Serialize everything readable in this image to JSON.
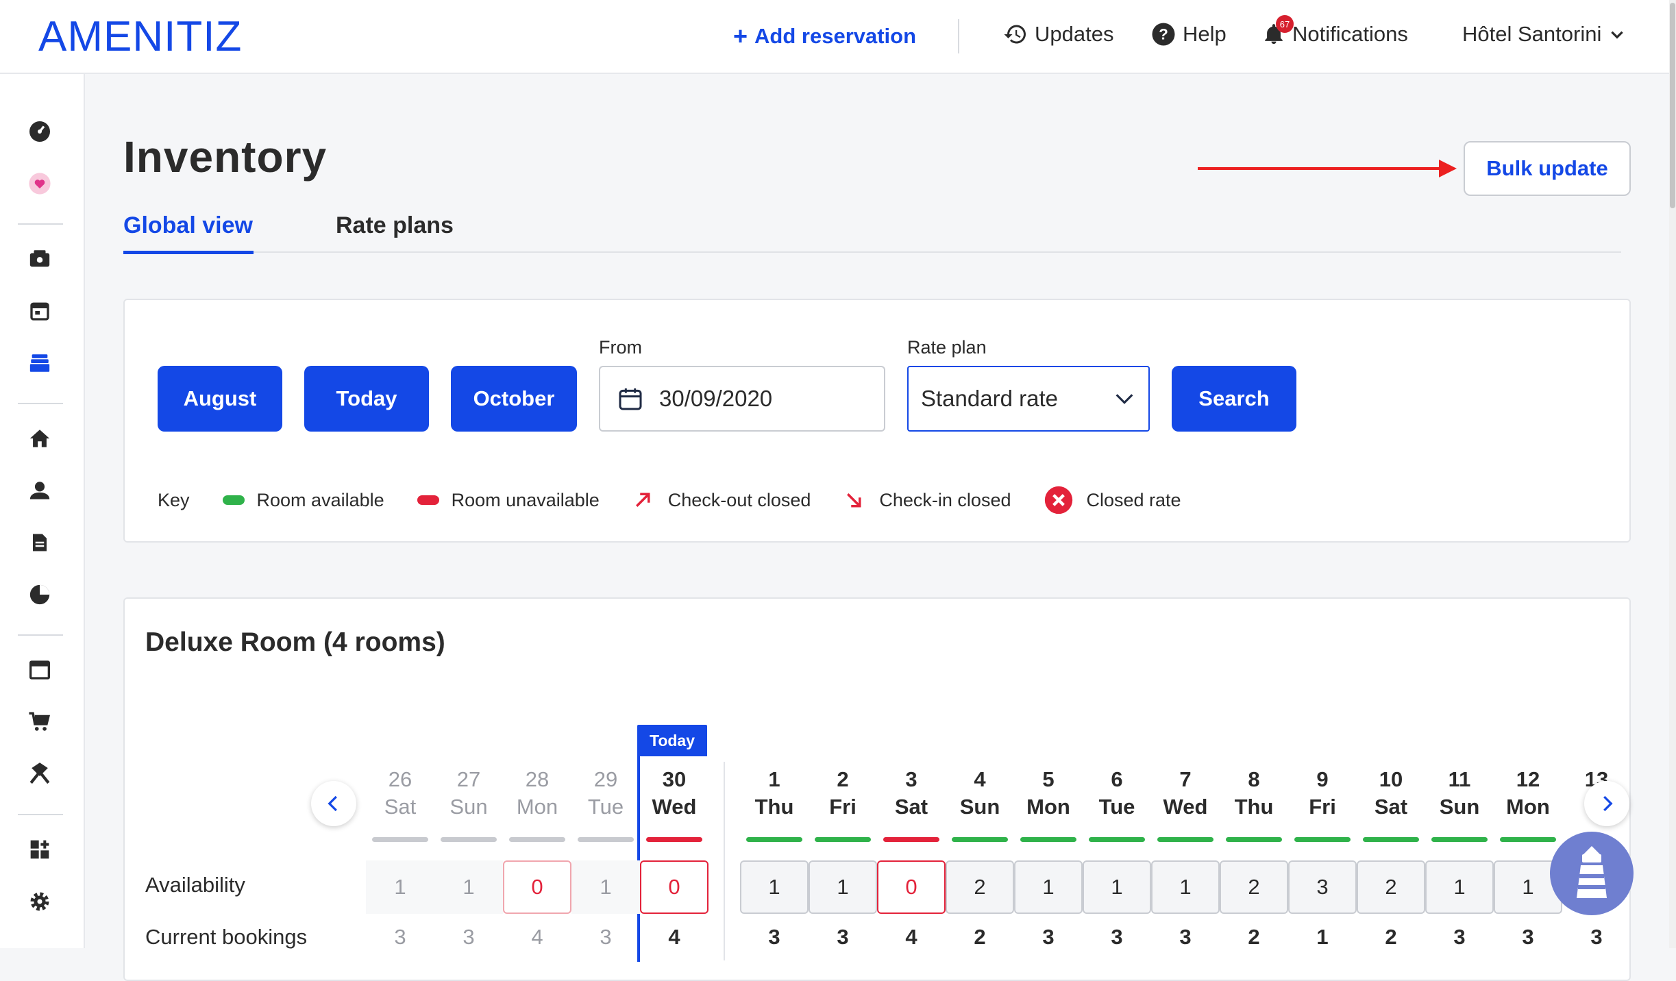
{
  "brand": {
    "logo": "AMENITIZ",
    "color": "#1448e6"
  },
  "topbar": {
    "add_reservation": "Add reservation",
    "updates": "Updates",
    "help": "Help",
    "notifications": "Notifications",
    "notifications_count": "67",
    "hotel": "Hôtel Santorini"
  },
  "page": {
    "title": "Inventory",
    "bulk_update": "Bulk update"
  },
  "tabs": {
    "global": "Global view",
    "rate_plans": "Rate plans"
  },
  "filters": {
    "prev_month": "August",
    "today": "Today",
    "next_month": "October",
    "from_label": "From",
    "from_value": "30/09/2020",
    "rate_plan_label": "Rate plan",
    "rate_plan_value": "Standard rate",
    "search": "Search"
  },
  "key": {
    "label": "Key",
    "room_available": "Room available",
    "room_unavailable": "Room unavailable",
    "checkout_closed": "Check-out closed",
    "checkin_closed": "Check-in closed",
    "closed_rate": "Closed rate"
  },
  "room": {
    "title": "Deluxe Room (4 rooms)",
    "today_tag": "Today",
    "availability_label": "Availability",
    "bookings_label": "Current bookings",
    "days": [
      {
        "num": "26",
        "dow": "Sat",
        "avail": "1",
        "book": "3"
      },
      {
        "num": "27",
        "dow": "Sun",
        "avail": "1",
        "book": "3"
      },
      {
        "num": "28",
        "dow": "Mon",
        "avail": "0",
        "book": "4"
      },
      {
        "num": "29",
        "dow": "Tue",
        "avail": "1",
        "book": "3"
      },
      {
        "num": "30",
        "dow": "Wed",
        "avail": "0",
        "book": "4"
      },
      {
        "num": "1",
        "dow": "Thu",
        "avail": "1",
        "book": "3"
      },
      {
        "num": "2",
        "dow": "Fri",
        "avail": "1",
        "book": "3"
      },
      {
        "num": "3",
        "dow": "Sat",
        "avail": "0",
        "book": "4"
      },
      {
        "num": "4",
        "dow": "Sun",
        "avail": "2",
        "book": "2"
      },
      {
        "num": "5",
        "dow": "Mon",
        "avail": "1",
        "book": "3"
      },
      {
        "num": "6",
        "dow": "Tue",
        "avail": "1",
        "book": "3"
      },
      {
        "num": "7",
        "dow": "Wed",
        "avail": "1",
        "book": "3"
      },
      {
        "num": "8",
        "dow": "Thu",
        "avail": "2",
        "book": "2"
      },
      {
        "num": "9",
        "dow": "Fri",
        "avail": "3",
        "book": "1"
      },
      {
        "num": "10",
        "dow": "Sat",
        "avail": "2",
        "book": "2"
      },
      {
        "num": "11",
        "dow": "Sun",
        "avail": "1",
        "book": "3"
      },
      {
        "num": "12",
        "dow": "Mon",
        "avail": "1",
        "book": "3"
      },
      {
        "num": "13",
        "dow": "T",
        "avail": "",
        "book": "3"
      }
    ]
  },
  "colors": {
    "available": "#2fb24a",
    "unavailable": "#e3223a",
    "past": "#c8cacf"
  }
}
